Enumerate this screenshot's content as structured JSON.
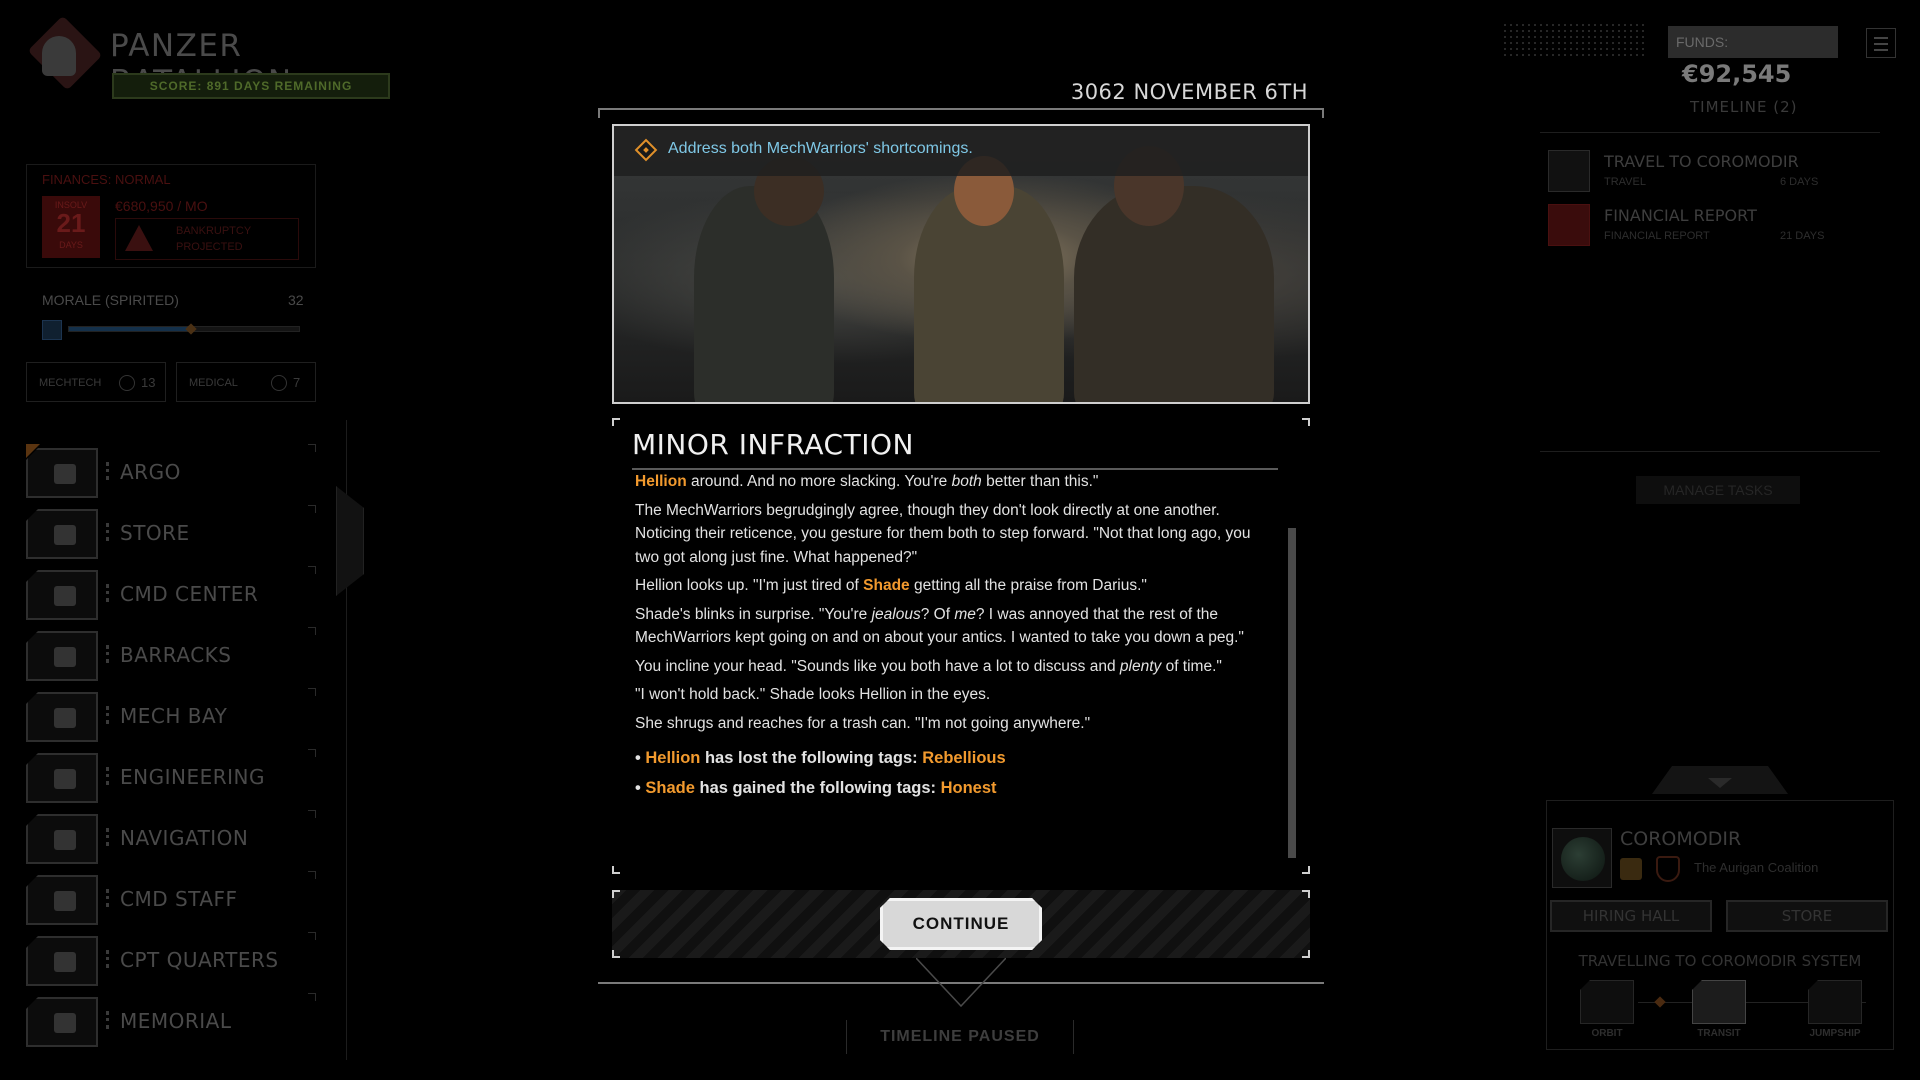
{
  "company": {
    "name": "PANZER BATALLION",
    "score": "SCORE: 891 DAYS REMAINING"
  },
  "finances": {
    "title": "FINANCES: NORMAL",
    "box_top": "INSOLV",
    "box_value": "21",
    "box_bottom": "DAYS",
    "rate": "€680,950 / MO",
    "bankruptcy": "BANKRUPTCY PROJECTED"
  },
  "morale": {
    "label": "MORALE (SPIRITED)",
    "value": "32",
    "level": 0.53
  },
  "crew": {
    "mechtech_label": "MECHTECH",
    "mechtech_value": "13",
    "medical_label": "MEDICAL",
    "medical_value": "7"
  },
  "nav": {
    "items": [
      {
        "label": "ARGO",
        "icon": "argo-ship-icon"
      },
      {
        "label": "STORE",
        "icon": "store-icon"
      },
      {
        "label": "CMD CENTER",
        "icon": "cmd-center-icon"
      },
      {
        "label": "BARRACKS",
        "icon": "barracks-icon"
      },
      {
        "label": "MECH BAY",
        "icon": "mech-bay-icon"
      },
      {
        "label": "ENGINEERING",
        "icon": "engineering-icon"
      },
      {
        "label": "NAVIGATION",
        "icon": "navigation-icon"
      },
      {
        "label": "CMD STAFF",
        "icon": "cmd-staff-icon"
      },
      {
        "label": "CPT QUARTERS",
        "icon": "cpt-quarters-icon"
      },
      {
        "label": "MEMORIAL",
        "icon": "memorial-icon"
      }
    ]
  },
  "funds": {
    "label": "FUNDS:",
    "value": "€92,545"
  },
  "timeline": {
    "title": "TIMELINE (2)",
    "items": [
      {
        "name": "TRAVEL TO COROMODIR",
        "type": "TRAVEL",
        "days": "6 DAYS",
        "icon": "travel-icon"
      },
      {
        "name": "FINANCIAL REPORT",
        "type": "FINANCIAL REPORT",
        "days": "21 DAYS",
        "icon": "financial-report-icon"
      }
    ],
    "manage_label": "MANAGE TASKS",
    "paused": "TIMELINE PAUSED"
  },
  "system": {
    "name": "COROMODIR",
    "faction": "The Aurigan Coalition",
    "hiring_hall": "HIRING HALL",
    "store": "STORE",
    "travelling": "TRAVELLING TO COROMODIR SYSTEM",
    "stages": [
      "ORBIT",
      "TRANSIT",
      "JUMPSHIP"
    ],
    "current_stage": "TRANSIT"
  },
  "event": {
    "date": "3062 NOVEMBER 6TH",
    "objective": "Address both MechWarriors' shortcomings.",
    "title": "MINOR INFRACTION",
    "p1_name": "Hellion",
    "p1_a": " around. And no more slacking. You're ",
    "p1_em": "both",
    "p1_b": " better than this.\"",
    "p2": "The MechWarriors begrudgingly agree, though they don't look directly at one another. Noticing their reticence, you gesture for them both to step forward. \"Not that long ago, you two got along just fine. What happened?\"",
    "p3_a": "Hellion looks up. \"I'm just tired of ",
    "p3_name": "Shade",
    "p3_b": " getting all the praise from Darius.\"",
    "p4_a": "Shade's blinks in surprise. \"You're ",
    "p4_em1": "jealous",
    "p4_b": "? Of ",
    "p4_em2": "me",
    "p4_c": "? I was annoyed that the rest of the MechWarriors kept going on and on about your antics. I wanted to take you down a peg.\"",
    "p5_a": "You incline your head. \"Sounds like you both have a lot to discuss and ",
    "p5_em": "plenty",
    "p5_b": " of time.\"",
    "p6": "\"I won't hold back.\" Shade looks Hellion in the eyes.",
    "p7": "She shrugs and reaches for a trash can. \"I'm not going anywhere.\"",
    "r1_bullet": "• ",
    "r1_name": "Hellion",
    "r1_text": " has lost the following tags: ",
    "r1_tag": "Rebellious",
    "r2_bullet": "• ",
    "r2_name": "Shade",
    "r2_text": " has gained the following tags: ",
    "r2_tag": "Honest",
    "continue_label": "CONTINUE"
  },
  "colors": {
    "highlight": "#f29a2e",
    "objective": "#7fc8e6",
    "finances_red": "#3a0a0a"
  }
}
